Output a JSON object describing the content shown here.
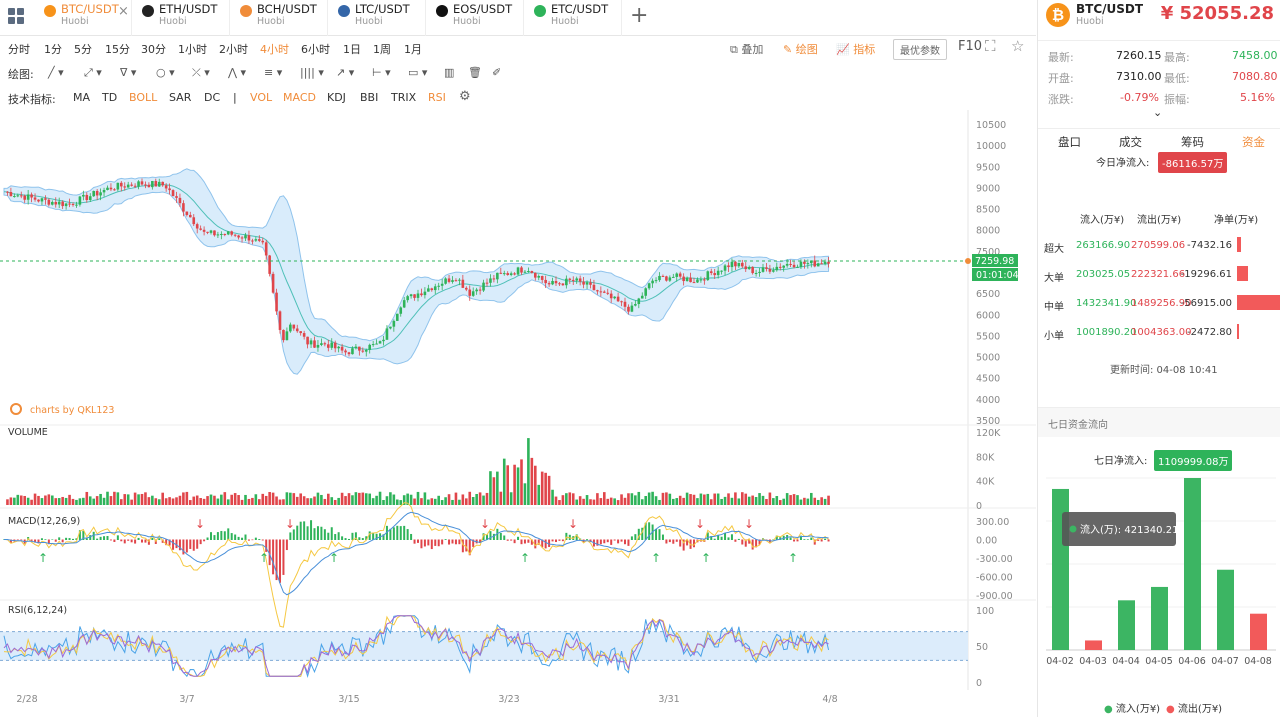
{
  "tabs": [
    {
      "pair": "BTC/USDT",
      "exchange": "Huobi",
      "color": "#f7931a",
      "active": true
    },
    {
      "pair": "ETH/USDT",
      "exchange": "Huobi",
      "color": "#222"
    },
    {
      "pair": "BCH/USDT",
      "exchange": "Huobi",
      "color": "#f08c3a"
    },
    {
      "pair": "LTC/USDT",
      "exchange": "Huobi",
      "color": "#3466a8"
    },
    {
      "pair": "EOS/USDT",
      "exchange": "Huobi",
      "color": "#111"
    },
    {
      "pair": "ETC/USDT",
      "exchange": "Huobi",
      "color": "#2eb35a"
    }
  ],
  "periods": [
    "分时",
    "1分",
    "5分",
    "15分",
    "30分",
    "1小时",
    "2小时",
    "4小时",
    "6小时",
    "1日",
    "1周",
    "1月"
  ],
  "active_period": "4小时",
  "toolbar": {
    "overlay": "叠加",
    "draw": "绘图",
    "indicator": "指标",
    "optimal": "最优参数",
    "f10": "F10"
  },
  "draw_label": "绘图:",
  "indicators_label": "技术指标:",
  "indicators": [
    "MA",
    "TD",
    "BOLL",
    "SAR",
    "DC",
    "|",
    "VOL",
    "MACD",
    "KDJ",
    "BBI",
    "TRIX",
    "RSI"
  ],
  "active_indicators": [
    "BOLL",
    "VOL",
    "MACD",
    "RSI"
  ],
  "chart": {
    "watermark": "charts by QKL123",
    "price_ticks": [
      "10500",
      "10000",
      "9500",
      "9000",
      "8500",
      "8000",
      "7500",
      "7000",
      "6500",
      "6000",
      "5500",
      "5000",
      "4500",
      "4000",
      "3500"
    ],
    "last_price": "7259.98",
    "countdown": "01:01:04",
    "volume_label": "VOLUME",
    "vol_ticks": [
      "120K",
      "80K",
      "40K",
      "0"
    ],
    "macd_label": "MACD(12,26,9)",
    "macd_ticks": [
      "300.00",
      "0.00",
      "-300.00",
      "-600.00",
      "-900.00"
    ],
    "rsi_label": "RSI(6,12,24)",
    "rsi_ticks": [
      "100",
      "50",
      "0"
    ],
    "dates": [
      "2/28",
      "3/7",
      "3/15",
      "3/23",
      "3/31",
      "4/8"
    ]
  },
  "quote": {
    "pair": "BTC/USDT",
    "exchange": "Huobi",
    "big_price": "¥ 52055.28",
    "latest_label": "最新:",
    "latest": "7260.15",
    "high_label": "最高:",
    "high": "7458.00",
    "open_label": "开盘:",
    "open": "7310.00",
    "low_label": "最低:",
    "low": "7080.80",
    "change_label": "涨跌:",
    "change": "-0.79%",
    "amp_label": "振幅:",
    "amp": "5.16%"
  },
  "right_tabs": [
    "盘口",
    "成交",
    "筹码",
    "资金"
  ],
  "flow": {
    "today_label": "今日净流入:",
    "today_value": "-86116.57万",
    "headers": [
      "流入(万¥)",
      "流出(万¥)",
      "净单(万¥)"
    ],
    "rows": [
      {
        "name": "超大",
        "in": "263166.90",
        "out": "270599.06",
        "net": "-7432.16",
        "bar": 0.08
      },
      {
        "name": "大单",
        "in": "203025.05",
        "out": "222321.66",
        "net": "-19296.61",
        "bar": 0.25
      },
      {
        "name": "中单",
        "in": "1432341.90",
        "out": "1489256.90",
        "net": "-56915.00",
        "bar": 1.0
      },
      {
        "name": "小单",
        "in": "1001890.20",
        "out": "1004363.00",
        "net": "-2472.80",
        "bar": 0.03
      }
    ],
    "update_time": "更新时间: 04-08 10:41"
  },
  "seven": {
    "title": "七日资金流向",
    "net_label": "七日净流入:",
    "net_value": "1109999.08万",
    "tooltip": "流入(万): 421340.21",
    "legend_in": "流入(万¥)",
    "legend_out": "流出(万¥)",
    "colors": {
      "in": "#3cb563",
      "out": "#f25a5a"
    }
  },
  "chart_data": {
    "type": "bar",
    "categories": [
      "04-02",
      "04-03",
      "04-04",
      "04-05",
      "04-06",
      "04-07",
      "04-08"
    ],
    "series": [
      {
        "name": "流入(万¥)",
        "values": [
          421340,
          0,
          130000,
          165000,
          450000,
          210000,
          0
        ]
      },
      {
        "name": "流出(万¥)",
        "values": [
          0,
          25000,
          0,
          0,
          0,
          0,
          95000
        ]
      }
    ]
  }
}
